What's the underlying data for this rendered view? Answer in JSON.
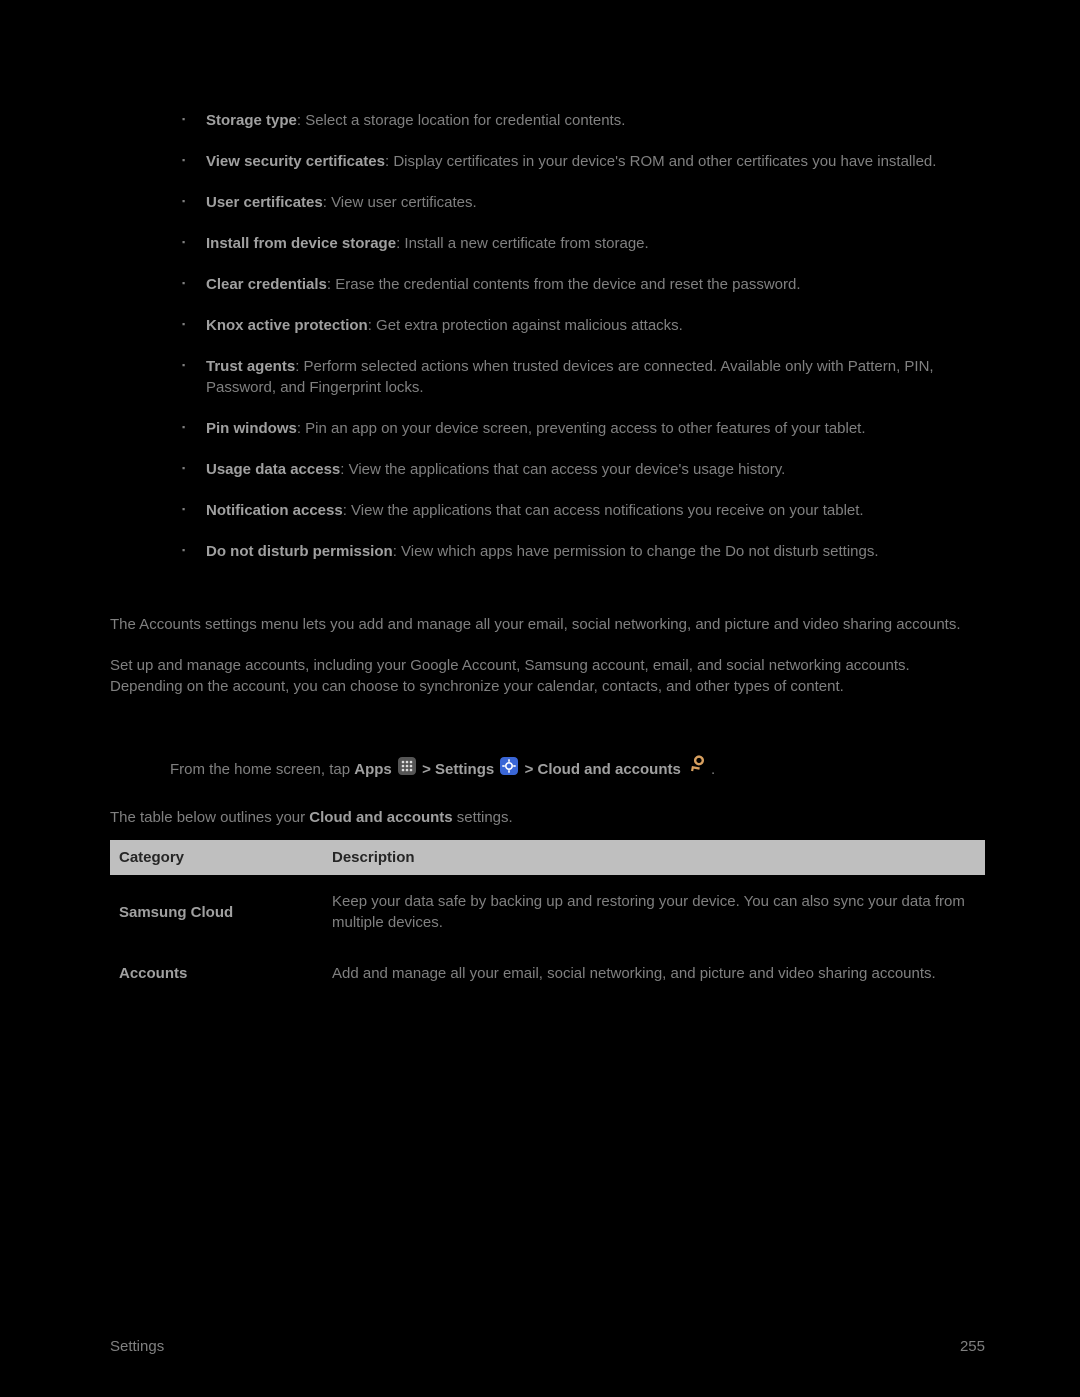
{
  "bullet_items": [
    {
      "term": "Storage type",
      "desc": ": Select a storage location for credential contents."
    },
    {
      "term": "View security certificates",
      "desc": ": Display certificates in your device's ROM and other certificates you have installed."
    },
    {
      "term": "User certificates",
      "desc": ": View user certificates."
    },
    {
      "term": "Install from device storage",
      "desc": ": Install a new certificate from storage."
    },
    {
      "term": "Clear credentials",
      "desc": ": Erase the credential contents from the device and reset the password."
    },
    {
      "term": "Knox active protection",
      "desc": ": Get extra protection against malicious attacks."
    },
    {
      "term": "Trust agents",
      "desc": ": Perform selected actions when trusted devices are connected. Available only with Pattern, PIN, Password, and Fingerprint locks."
    },
    {
      "term": "Pin windows",
      "desc": ": Pin an app on your device screen, preventing access to other features of your tablet."
    },
    {
      "term": "Usage data access",
      "desc": ": View the applications that can access your device's usage history."
    },
    {
      "term": "Notification access",
      "desc": ": View the applications that can access notifications you receive on your tablet."
    },
    {
      "term": "Do not disturb permission",
      "desc": ": View which apps have permission to change the Do not disturb settings."
    }
  ],
  "accounts_para1": "The Accounts settings menu lets you add and manage all your email, social networking, and picture and video sharing accounts.",
  "accounts_para2": "Set up and manage accounts, including your Google Account, Samsung account, email, and social networking accounts. Depending on the account, you can choose to synchronize your calendar, contacts, and other types of content.",
  "nav": {
    "prefix": "From the home screen, tap ",
    "apps_label": "Apps",
    "sep1": " > ",
    "settings_label": "Settings",
    "sep2": " > ",
    "cloud_label": "Cloud and accounts",
    "period": "."
  },
  "table_intro_pre": "The table below outlines your ",
  "table_intro_bold": "Cloud and accounts",
  "table_intro_post": " settings.",
  "table": {
    "head1": "Category",
    "head2": "Description",
    "rows": [
      {
        "cat": "Samsung Cloud",
        "desc": "Keep your data safe by backing up and restoring your device. You can also sync your data from multiple devices."
      },
      {
        "cat": "Accounts",
        "desc": "Add and manage all your email, social networking, and picture and video sharing accounts."
      }
    ]
  },
  "footer": {
    "left": "Settings",
    "right": "255"
  }
}
